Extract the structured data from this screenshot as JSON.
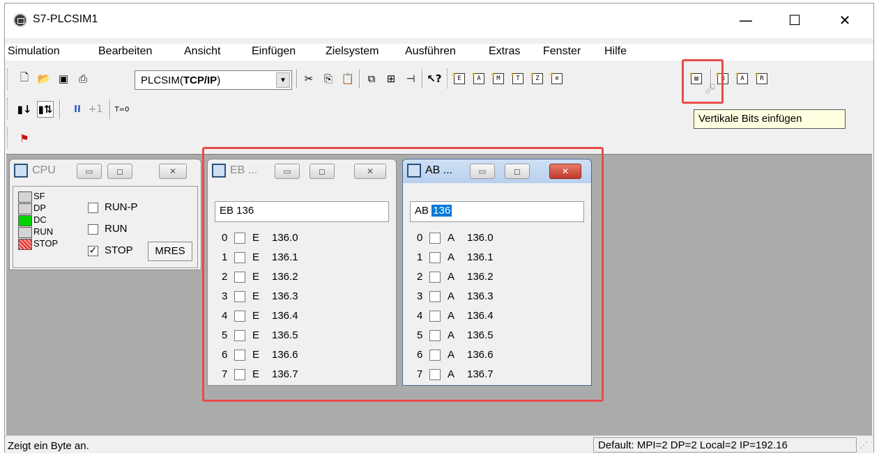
{
  "app": {
    "title": "S7-PLCSIM1",
    "window_controls": {
      "minimize": "—",
      "maximize": "☐",
      "close": "✕"
    }
  },
  "menu": [
    "Simulation",
    "Bearbeiten",
    "Ansicht",
    "Einfügen",
    "Zielsystem",
    "Ausführen",
    "Extras",
    "Fenster",
    "Hilfe"
  ],
  "toolbar": {
    "connection_prefix": "PLCSIM(",
    "connection_bold": "TCP/IP",
    "connection_suffix": ")",
    "icons": [
      "new-icon",
      "open-icon",
      "save-icon",
      "print-icon",
      "cut-icon",
      "copy-icon",
      "paste-icon",
      "cascade-icon",
      "tile-icon",
      "pin-icon",
      "help-icon",
      "insert-input-icon",
      "insert-output-icon",
      "insert-memory-icon",
      "insert-timer-icon",
      "insert-counter-icon",
      "insert-generic-icon",
      "insert-vertical-bits-icon",
      "insert-stack-icon",
      "insert-accu-icon",
      "insert-register-icon"
    ],
    "ins_letters": [
      "E",
      "A",
      "M",
      "T",
      "Z",
      "≡",
      "▤",
      "≣",
      "A",
      "R"
    ],
    "pause_label": "II",
    "step_label": "+1",
    "t0_label": "T=0",
    "tooltip": "Vertikale Bits einfügen"
  },
  "cpu_window": {
    "title": "CPU",
    "leds": [
      {
        "label": "SF",
        "color": "#d4d4d4"
      },
      {
        "label": "DP",
        "color": "#d4d4d4"
      },
      {
        "label": "DC",
        "color": "#00d200"
      },
      {
        "label": "RUN",
        "color": "#d4d4d4"
      },
      {
        "label": "STOP",
        "color": "#e03030"
      }
    ],
    "modes": [
      {
        "label": "RUN-P",
        "checked": false
      },
      {
        "label": "RUN",
        "checked": false
      },
      {
        "label": "STOP",
        "checked": true
      }
    ],
    "mres_label": "MRES"
  },
  "eb_window": {
    "title": "EB ...",
    "input_value": "EB  136",
    "bits": [
      {
        "idx": "0",
        "type": "E",
        "addr": "136.0"
      },
      {
        "idx": "1",
        "type": "E",
        "addr": "136.1"
      },
      {
        "idx": "2",
        "type": "E",
        "addr": "136.2"
      },
      {
        "idx": "3",
        "type": "E",
        "addr": "136.3"
      },
      {
        "idx": "4",
        "type": "E",
        "addr": "136.4"
      },
      {
        "idx": "5",
        "type": "E",
        "addr": "136.5"
      },
      {
        "idx": "6",
        "type": "E",
        "addr": "136.6"
      },
      {
        "idx": "7",
        "type": "E",
        "addr": "136.7"
      }
    ]
  },
  "ab_window": {
    "title": "AB ...",
    "input_prefix": "AB",
    "input_selected": "136",
    "bits": [
      {
        "idx": "0",
        "type": "A",
        "addr": "136.0"
      },
      {
        "idx": "1",
        "type": "A",
        "addr": "136.1"
      },
      {
        "idx": "2",
        "type": "A",
        "addr": "136.2"
      },
      {
        "idx": "3",
        "type": "A",
        "addr": "136.3"
      },
      {
        "idx": "4",
        "type": "A",
        "addr": "136.4"
      },
      {
        "idx": "5",
        "type": "A",
        "addr": "136.5"
      },
      {
        "idx": "6",
        "type": "A",
        "addr": "136.6"
      },
      {
        "idx": "7",
        "type": "A",
        "addr": "136.7"
      }
    ]
  },
  "status": {
    "left": "Zeigt ein Byte an.",
    "right": "Default:  MPI=2 DP=2 Local=2 IP=192.16"
  },
  "colors": {
    "highlight": "#e84b4b",
    "mdi_background": "#ababab",
    "tooltip_background": "#ffffe1",
    "selection": "#0078d7"
  }
}
